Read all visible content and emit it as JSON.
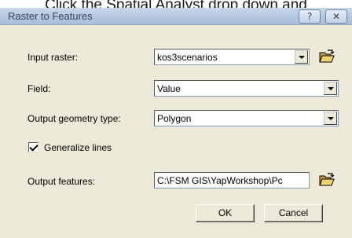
{
  "caption": "Click the Spatial Analyst drop down and",
  "window": {
    "title": "Raster to Features",
    "help_glyph": "?",
    "close_glyph": "✕"
  },
  "form": {
    "input_raster_label": "Input raster:",
    "input_raster_value": "kos3scenarios",
    "field_label": "Field:",
    "field_value": "Value",
    "geometry_label": "Output geometry type:",
    "geometry_value": "Polygon",
    "generalize_label": "Generalize lines",
    "generalize_checked": true,
    "output_label": "Output features:",
    "output_value": "C:\\FSM GIS\\YapWorkshop\\Pc"
  },
  "buttons": {
    "ok": "OK",
    "cancel": "Cancel"
  },
  "icons": {
    "folder": "open-folder-icon",
    "dropdown": "chevron-down-icon",
    "help": "help-icon",
    "close": "close-icon",
    "check": "checkmark-icon"
  }
}
